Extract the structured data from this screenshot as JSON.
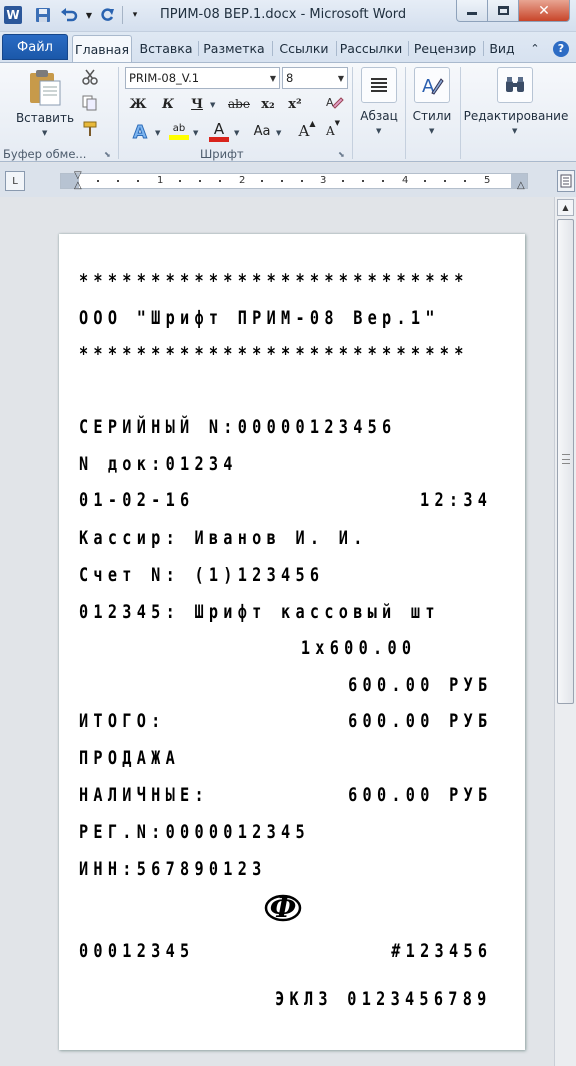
{
  "window": {
    "title": "ПРИМ-08 ВЕР.1.docx - Microsoft Word",
    "app_icon": "W"
  },
  "ribbon_tabs": {
    "file": "Файл",
    "tabs": [
      "Главная",
      "Вставка",
      "Разметка",
      "Ссылки",
      "Рассылки",
      "Рецензир",
      "Вид"
    ],
    "active": "Главная"
  },
  "clipboard": {
    "paste_label": "Вставить",
    "group_label": "Буфер обме..."
  },
  "font": {
    "font_name": "PRIM-08_V.1",
    "font_size": "8",
    "bold": "Ж",
    "italic": "К",
    "underline": "Ч",
    "strike": "abe",
    "subscript": "x₂",
    "superscript": "x²",
    "highlight_letters": "ab",
    "font_color_letter": "A",
    "change_case": "Aa",
    "grow": "A",
    "shrink": "A",
    "group_label": "Шрифт"
  },
  "paragraph": {
    "label": "Абзац"
  },
  "styles": {
    "label": "Стили"
  },
  "editing": {
    "label": "Редактирование"
  },
  "ruler": {
    "numbers": [
      "1",
      "2",
      "3",
      "4",
      "5"
    ]
  },
  "receipt": {
    "stars": "***************************",
    "header": "ООО \"Шрифт ПРИМ-08 Вер.1\"",
    "serial": "СЕРИЙНЫЙ N:00000123456",
    "doc_no": "N док:01234",
    "date": "01-02-16",
    "time": "12:34",
    "cashier": "Кассир: Иванов И. И.",
    "account": "Счет N: (1)123456",
    "item": "012345: Шрифт кассовый шт",
    "qty_price": "1x600.00",
    "line_total": "600.00 РУБ",
    "total_label": "ИТОГО:",
    "total_value": "600.00 РУБ",
    "sale": "ПРОДАЖА",
    "cash_label": "НАЛИЧНЫЕ:",
    "cash_value": "600.00 РУБ",
    "reg_no": "РЕГ.N:0000012345",
    "inn": "ИНН:567890123",
    "fiscal_mark": "Ф",
    "doc_number": "00012345",
    "check_number": "#123456",
    "eklz": "ЭКЛЗ 0123456789"
  },
  "colors": {
    "accent": "#1b58a9",
    "highlight": "#ffff00",
    "font_color": "#d9241c"
  }
}
